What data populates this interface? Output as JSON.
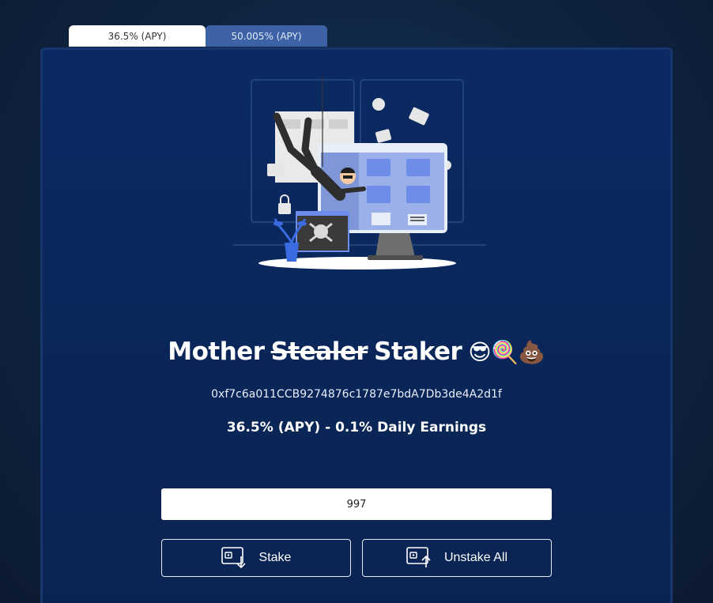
{
  "tabs": [
    {
      "label": "36.5% (APY)",
      "active": true
    },
    {
      "label": "50.005% (APY)",
      "active": false
    }
  ],
  "header": {
    "title_prefix": "Mother",
    "title_struck": "Stealer",
    "title_suffix": "Staker",
    "emojis": "😎🍭💩"
  },
  "contract": {
    "address": "0xf7c6a011CCB9274876c1787e7bdA7Db3de4A2d1f"
  },
  "rate_text": "36.5% (APY) - 0.1% Daily Earnings",
  "stake_form": {
    "amount": "997"
  },
  "actions": {
    "stake_label": "Stake",
    "unstake_label": "Unstake All",
    "stake_icon": "wallet-deposit-icon",
    "unstake_icon": "wallet-withdraw-icon"
  },
  "colors": {
    "card_background": "#0b2a63",
    "active_tab": "#ffffff",
    "inactive_tab": "#3d63a6"
  }
}
